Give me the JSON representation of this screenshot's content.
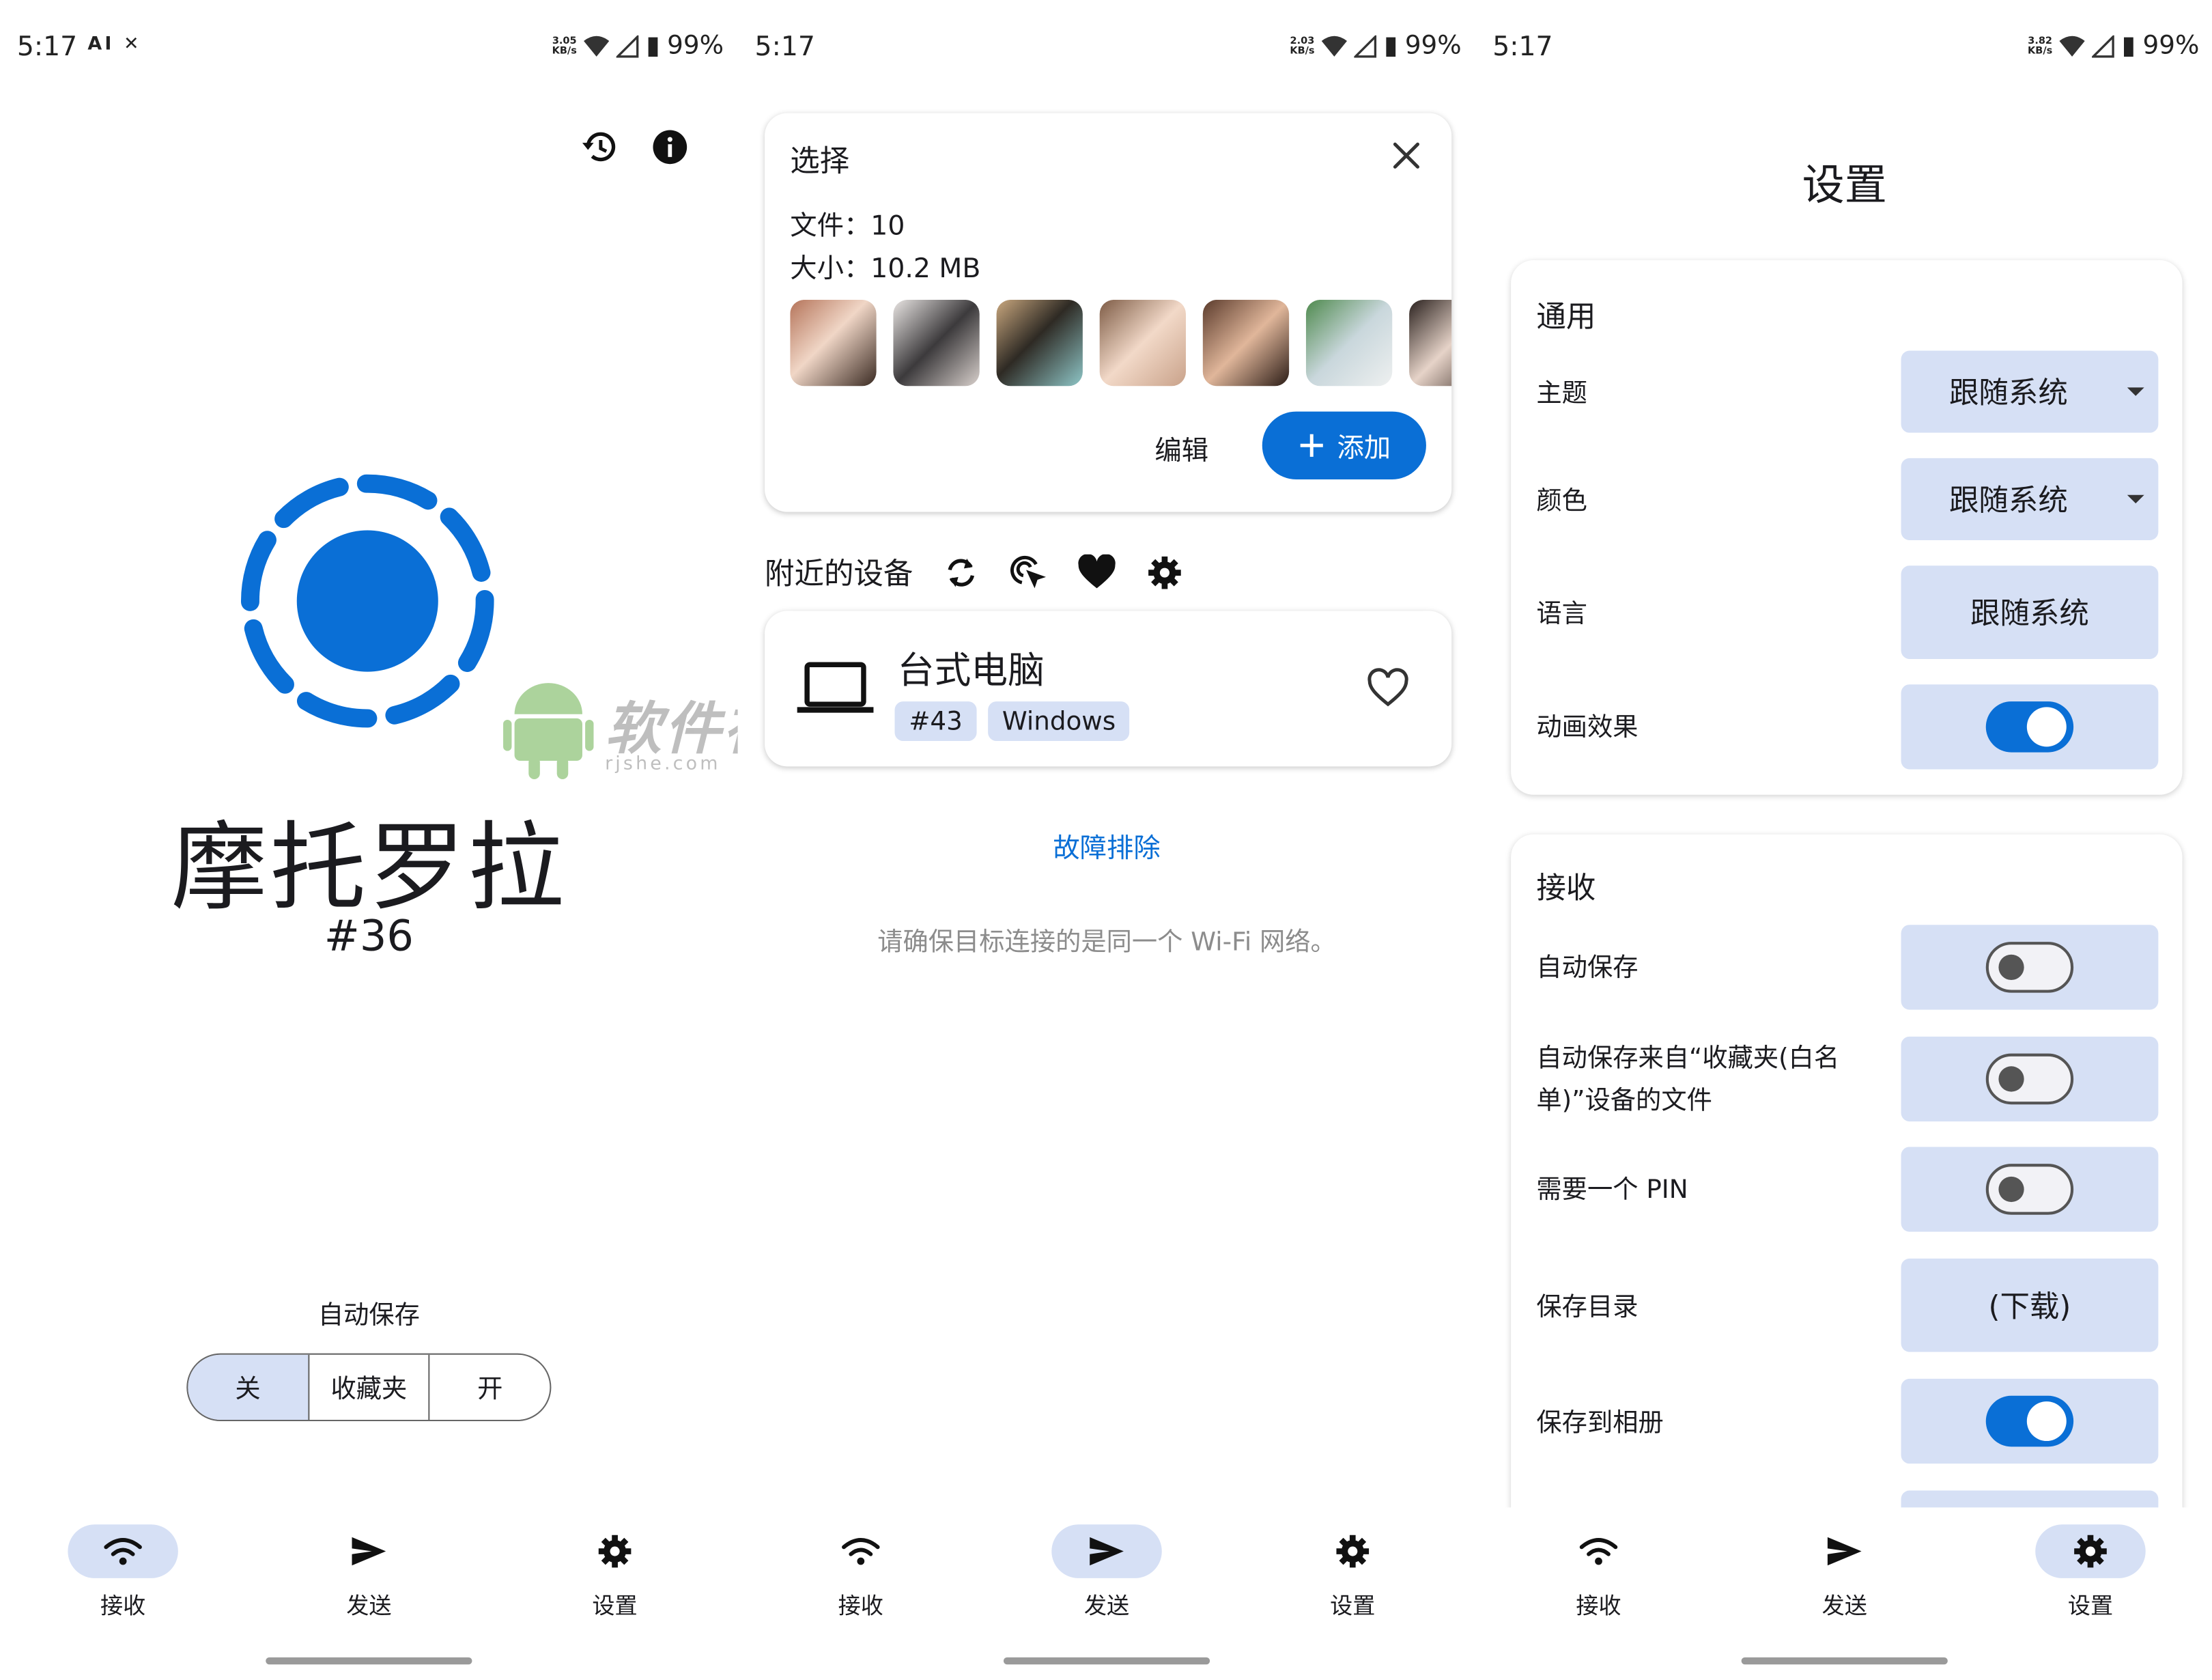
{
  "status_bar": [
    {
      "time": "5:17",
      "icons": "AI ✕",
      "net_speed": "3.05",
      "net_unit": "KB/s",
      "battery": "99%"
    },
    {
      "time": "5:17",
      "icons": "",
      "net_speed": "2.03",
      "net_unit": "KB/s",
      "battery": "99%"
    },
    {
      "time": "5:17",
      "icons": "",
      "net_speed": "3.82",
      "net_unit": "KB/s",
      "battery": "99%"
    }
  ],
  "nav": {
    "receive": "接收",
    "send": "发送",
    "settings": "设置"
  },
  "receive": {
    "device_name": "摩托罗拉",
    "device_number": "#36",
    "auto_save_label": "自动保存",
    "segments": [
      "关",
      "收藏夹",
      "开"
    ],
    "selected_segment": 0,
    "accent": "#0a6fd6"
  },
  "watermark": {
    "title": "软件社",
    "subtitle": "rjshe.com"
  },
  "send": {
    "selection": {
      "title": "选择",
      "files": "文件：10",
      "size": "大小：10.2 MB",
      "edit": "编辑",
      "add": "添加",
      "thumbnail_count": 7
    },
    "nearby_title": "附近的设备",
    "device": {
      "name": "台式电脑",
      "number": "#43",
      "os": "Windows"
    },
    "troubleshoot": "故障排除",
    "hint": "请确保目标连接的是同一个 Wi-Fi 网络。"
  },
  "settings": {
    "title": "设置",
    "general": {
      "heading": "通用",
      "theme_label": "主题",
      "theme_value": "跟随系统",
      "color_label": "颜色",
      "color_value": "跟随系统",
      "language_label": "语言",
      "language_value": "跟随系统",
      "animation_label": "动画效果",
      "animation_on": true
    },
    "receive": {
      "heading": "接收",
      "auto_save_label": "自动保存",
      "auto_save_on": false,
      "auto_save_fav_label": "自动保存来自“收藏夹(白名单)”设备的文件",
      "auto_save_fav_on": false,
      "pin_label": "需要一个 PIN",
      "pin_on": false,
      "dir_label": "保存目录",
      "dir_value": "(下载)",
      "gallery_label": "保存到相册",
      "gallery_on": true
    }
  }
}
